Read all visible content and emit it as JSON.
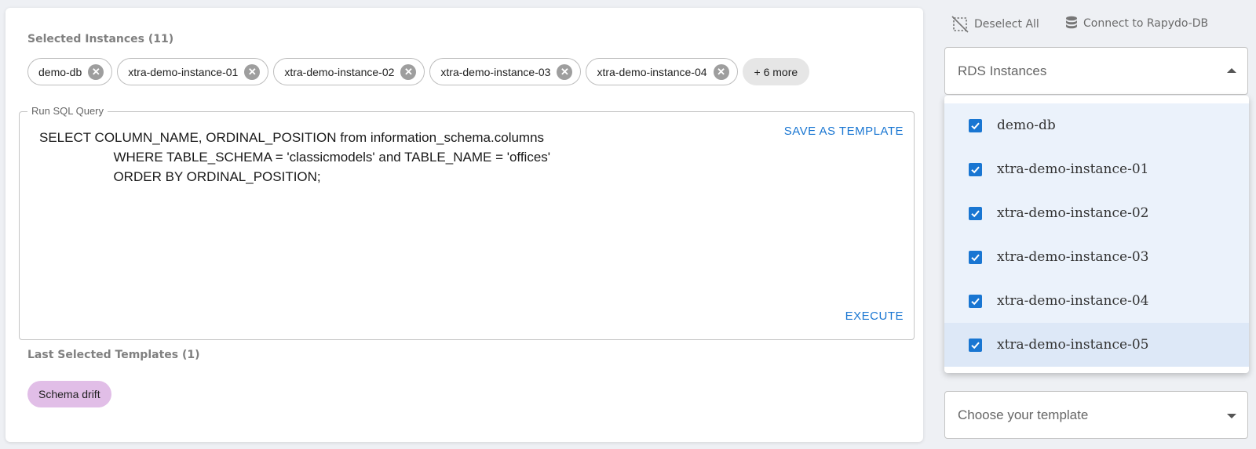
{
  "selected_instances": {
    "title": "Selected Instances (11)",
    "chips": [
      "demo-db",
      "xtra-demo-instance-01",
      "xtra-demo-instance-02",
      "xtra-demo-instance-03",
      "xtra-demo-instance-04"
    ],
    "more_label": "+ 6 more",
    "remove_icon": "close-circle-icon"
  },
  "query": {
    "legend": "Run SQL Query",
    "text": "SELECT COLUMN_NAME, ORDINAL_POSITION from information_schema.columns\n                    WHERE TABLE_SCHEMA = 'classicmodels' and TABLE_NAME = 'offices'\n                    ORDER BY ORDINAL_POSITION;",
    "save_template_label": "SAVE AS TEMPLATE",
    "execute_label": "EXECUTE"
  },
  "templates": {
    "title": "Last Selected Templates (1)",
    "chips": [
      "Schema drift"
    ]
  },
  "toolbar": {
    "deselect_all_label": "Deselect All",
    "deselect_icon": "deselect-icon",
    "connect_label": "Connect to Rapydo-DB",
    "connect_icon": "database-icon"
  },
  "rds_select": {
    "label": "RDS Instances",
    "open": true,
    "options": [
      {
        "label": "demo-db",
        "checked": true
      },
      {
        "label": "xtra-demo-instance-01",
        "checked": true
      },
      {
        "label": "xtra-demo-instance-02",
        "checked": true
      },
      {
        "label": "xtra-demo-instance-03",
        "checked": true
      },
      {
        "label": "xtra-demo-instance-04",
        "checked": true
      },
      {
        "label": "xtra-demo-instance-05",
        "checked": true
      }
    ]
  },
  "template_select": {
    "placeholder": "Choose your template"
  },
  "colors": {
    "accent": "#1976d2",
    "template_chip": "#e1bee7",
    "menu_item_bg": "#ebf2fb"
  }
}
